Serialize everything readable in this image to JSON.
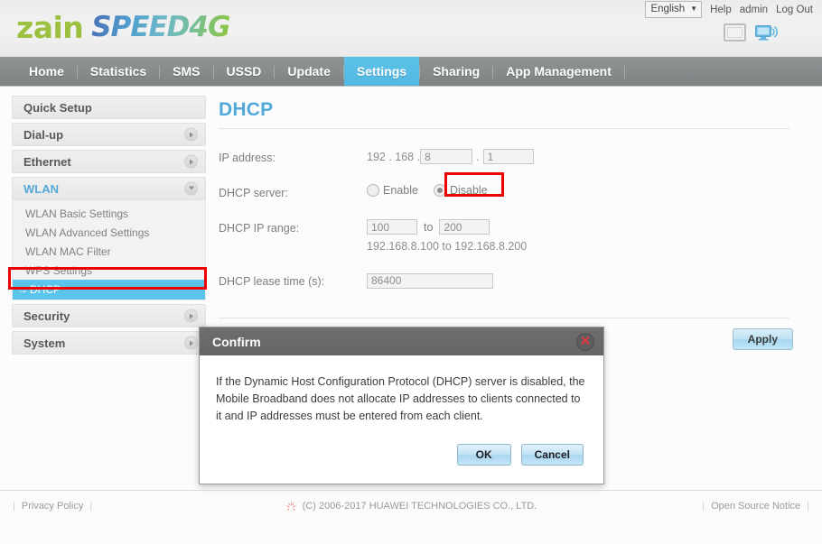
{
  "header": {
    "logo_zain": "zain",
    "logo_speed": "SPEED4G",
    "language": "English",
    "lang_caret": "▼",
    "help_label": "Help",
    "user_label": "admin",
    "logout_label": "Log Out"
  },
  "nav": {
    "items": [
      {
        "label": "Home",
        "active": false
      },
      {
        "label": "Statistics",
        "active": false
      },
      {
        "label": "SMS",
        "active": false
      },
      {
        "label": "USSD",
        "active": false
      },
      {
        "label": "Update",
        "active": false
      },
      {
        "label": "Settings",
        "active": true
      },
      {
        "label": "Sharing",
        "active": false
      },
      {
        "label": "App Management",
        "active": false
      }
    ]
  },
  "sidebar": {
    "groups": [
      {
        "label": "Quick Setup",
        "arrow": "none",
        "open": false,
        "items": []
      },
      {
        "label": "Dial-up",
        "arrow": "right",
        "open": false,
        "items": []
      },
      {
        "label": "Ethernet",
        "arrow": "right",
        "open": false,
        "items": []
      },
      {
        "label": "WLAN",
        "arrow": "down",
        "open": true,
        "items": [
          {
            "label": "WLAN Basic Settings",
            "selected": false
          },
          {
            "label": "WLAN Advanced Settings",
            "selected": false
          },
          {
            "label": "WLAN MAC Filter",
            "selected": false
          },
          {
            "label": "WPS Settings",
            "selected": false
          },
          {
            "label": "DHCP",
            "selected": true,
            "arrow": "→"
          }
        ]
      },
      {
        "label": "Security",
        "arrow": "right",
        "open": false,
        "items": []
      },
      {
        "label": "System",
        "arrow": "right",
        "open": false,
        "items": []
      }
    ]
  },
  "main": {
    "title": "DHCP",
    "ip_address": {
      "label": "IP address:",
      "prefix": "192 . 168 .",
      "octet3": "8",
      "separator": ".",
      "octet4": "1"
    },
    "dhcp_server": {
      "label": "DHCP server:",
      "enable_label": "Enable",
      "disable_label": "Disable",
      "selected": "Disable"
    },
    "dhcp_ip_range": {
      "label": "DHCP IP range:",
      "start": "100",
      "to_label": "to",
      "end": "200",
      "hint": "192.168.8.100 to 192.168.8.200"
    },
    "dhcp_lease_time": {
      "label": "DHCP lease time (s):",
      "value": "86400"
    },
    "apply_label": "Apply"
  },
  "dialog": {
    "title": "Confirm",
    "close_glyph": "✕",
    "message": "If the Dynamic Host Configuration Protocol (DHCP) server is disabled, the Mobile Broadband does not allocate IP addresses to clients connected to it and IP addresses must be entered from each client.",
    "ok_label": "OK",
    "cancel_label": "Cancel"
  },
  "footer": {
    "privacy_label": "Privacy Policy",
    "copyright": "(C) 2006-2017 HUAWEI TECHNOLOGIES CO., LTD.",
    "open_source_label": "Open Source Notice",
    "pipe": "|"
  },
  "colors": {
    "accent_blue": "#52a9d8",
    "nav_active": "#5ec2e8",
    "highlight_red": "#ef0000",
    "logo_green": "#9cc03f"
  }
}
